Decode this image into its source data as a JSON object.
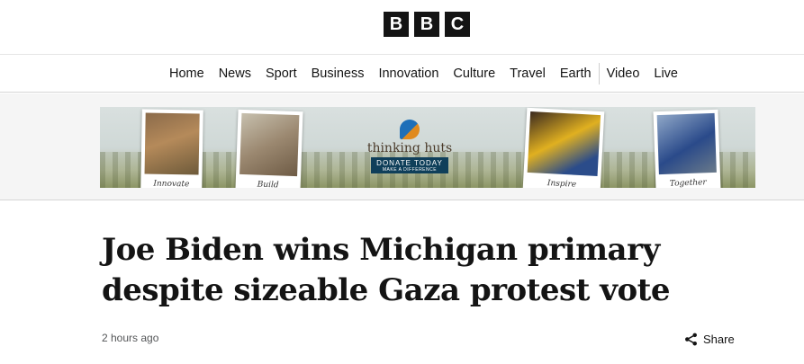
{
  "logo": {
    "letters": [
      "B",
      "B",
      "C"
    ]
  },
  "nav": {
    "items": [
      "Home",
      "News",
      "Sport",
      "Business",
      "Innovation",
      "Culture",
      "Travel",
      "Earth",
      "Video",
      "Live"
    ]
  },
  "ad": {
    "brand": "thinking huts",
    "donate": "DONATE TODAY",
    "donate_sub": "MAKE A DIFFERENCE",
    "captions": [
      "Innovate",
      "Build",
      "Inspire",
      "Together"
    ]
  },
  "article": {
    "headline": "Joe Biden wins Michigan primary despite sizeable Gaza protest vote",
    "timestamp": "2 hours ago",
    "share_label": "Share",
    "share_icon": "share-icon"
  }
}
